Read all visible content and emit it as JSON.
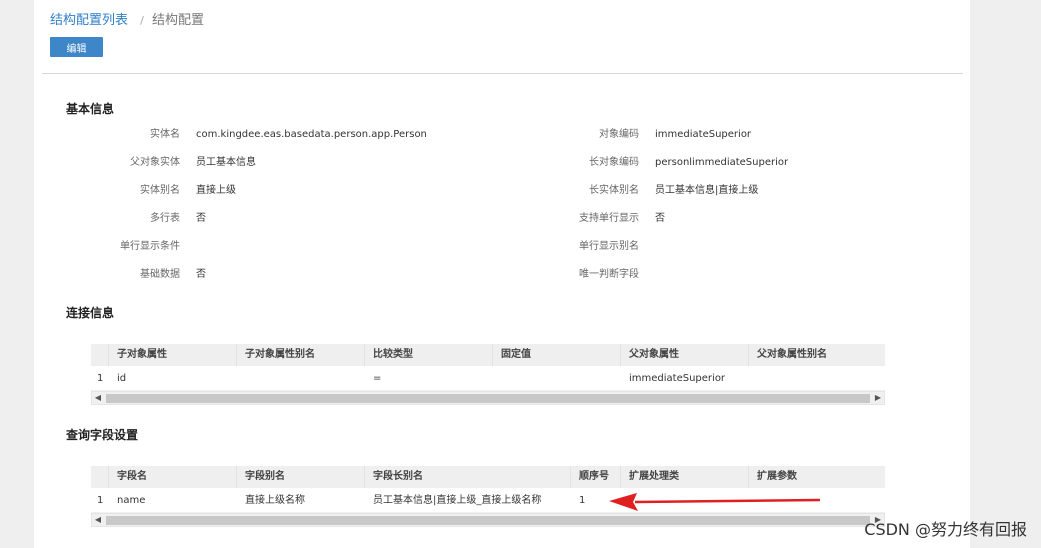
{
  "breadcrumb": {
    "parent": "结构配置列表",
    "separator": "/",
    "current": "结构配置"
  },
  "toolbar": {
    "edit_label": "编辑"
  },
  "basic_info": {
    "title": "基本信息",
    "left": [
      {
        "label": "实体名",
        "value": "com.kingdee.eas.basedata.person.app.Person"
      },
      {
        "label": "父对象实体",
        "value": "员工基本信息"
      },
      {
        "label": "实体别名",
        "value": "直接上级"
      },
      {
        "label": "多行表",
        "value": "否"
      },
      {
        "label": "单行显示条件",
        "value": ""
      },
      {
        "label": "基础数据",
        "value": "否"
      }
    ],
    "right": [
      {
        "label": "对象编码",
        "value": "immediateSuperior"
      },
      {
        "label": "长对象编码",
        "value": "personlimmediateSuperior"
      },
      {
        "label": "长实体别名",
        "value": "员工基本信息|直接上级"
      },
      {
        "label": "支持单行显示",
        "value": "否"
      },
      {
        "label": "单行显示别名",
        "value": ""
      },
      {
        "label": "唯一判断字段",
        "value": ""
      }
    ]
  },
  "link_info": {
    "title": "连接信息",
    "columns": [
      "子对象属性",
      "子对象属性别名",
      "比较类型",
      "固定值",
      "父对象属性",
      "父对象属性别名"
    ],
    "rows": [
      {
        "num": "1",
        "cells": [
          "id",
          "",
          "=",
          "",
          "immediateSuperior",
          ""
        ]
      }
    ]
  },
  "query_fields": {
    "title": "查询字段设置",
    "columns": [
      "字段名",
      "字段别名",
      "字段长别名",
      "顺序号",
      "扩展处理类",
      "扩展参数"
    ],
    "rows": [
      {
        "num": "1",
        "cells": [
          "name",
          "直接上级名称",
          "员工基本信息|直接上级_直接上级名称",
          "1",
          "",
          ""
        ]
      }
    ]
  },
  "colors": {
    "accent": "#3d86c8",
    "link": "#2f7fc9",
    "annotation_arrow": "#e02020"
  },
  "watermark": "CSDN @努力终有回报"
}
